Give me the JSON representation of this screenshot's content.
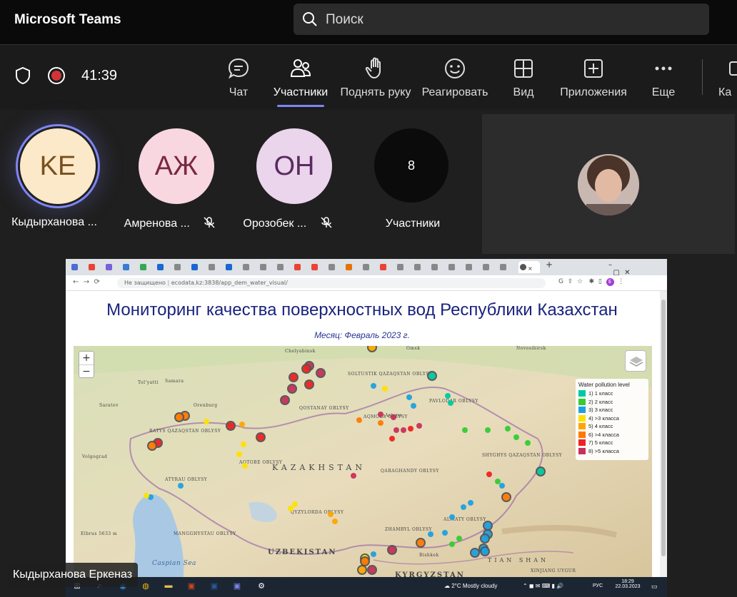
{
  "app": {
    "title": "Microsoft Teams",
    "search_placeholder": "Поиск"
  },
  "call": {
    "timer": "41:39",
    "recording": true
  },
  "toolbar": {
    "items": [
      {
        "label": "Чат",
        "icon": "chat-icon"
      },
      {
        "label": "Участники",
        "icon": "people-icon",
        "active": true
      },
      {
        "label": "Поднять руку",
        "icon": "raise-hand-icon"
      },
      {
        "label": "Реагировать",
        "icon": "smiley-icon"
      },
      {
        "label": "Вид",
        "icon": "grid-view-icon"
      },
      {
        "label": "Приложения",
        "icon": "add-app-icon"
      },
      {
        "label": "Еще",
        "icon": "more-icon"
      },
      {
        "label": "Ка",
        "icon": "camera-icon"
      }
    ]
  },
  "participants": [
    {
      "initials": "KE",
      "name": "Кыдырханова ...",
      "muted": false,
      "bg": "#fbe9c9",
      "fg": "#7a4f1c",
      "speaking": true
    },
    {
      "initials": "АЖ",
      "name": "Амренова ...",
      "muted": true,
      "bg": "#f8d7e1",
      "fg": "#7a2842"
    },
    {
      "initials": "OH",
      "name": "Орозобек ...",
      "muted": true,
      "bg": "#ead5ec",
      "fg": "#5a2a60"
    },
    {
      "initials": "8",
      "name": "Участники",
      "muted": false,
      "bg": "#0b0b0b",
      "fg": "#ffffff"
    }
  ],
  "presenter_tag": "Кыдырханова Еркеназ",
  "shared_screen": {
    "address_insecure": "Не защищено",
    "address_url": "ecodata.kz:3838/app_dem_water_visual/",
    "page_title": "Мониторинг качества поверхностных вод Республики Казахстан",
    "month": "Месяц: Февраль 2023 г.",
    "zoom_in": "+",
    "zoom_out": "−",
    "legend": {
      "title": "Water pollution level",
      "items": [
        {
          "label": "1) 1 класс",
          "color": "#00c8a0"
        },
        {
          "label": "2) 2 класс",
          "color": "#33cc33"
        },
        {
          "label": "3) 3 класс",
          "color": "#1ea0e0"
        },
        {
          "label": "4) >3 класса",
          "color": "#ffe000"
        },
        {
          "label": "5) 4 класс",
          "color": "#ffa500"
        },
        {
          "label": "6) >4 класса",
          "color": "#ff7a00"
        },
        {
          "label": "7) 5 класс",
          "color": "#ee2222"
        },
        {
          "label": "8) >5 класса",
          "color": "#c8305a"
        }
      ]
    },
    "map_labels": [
      "KAZAKHSTAN",
      "UZBEKISTAN",
      "KYRGYZSTAN",
      "TIAN SHAN",
      "Caspian Sea",
      "Chelyabinsk",
      "Omsk",
      "Novosibirsk",
      "Samara",
      "Tol'yatti",
      "Saratov",
      "Orenburg",
      "Volgograd",
      "Astana",
      "Bishkek",
      "BATYS QAZAQSTAN OBLYSY",
      "ATYRAU OBLYSY",
      "MANGGHYSTAU OBLYSY",
      "AQTOBE OBLYSY",
      "QOSTANAY OBLYSY",
      "SOLTUSTIK QAZAQSTAN OBLYSY",
      "AQMOLA OBLYSY",
      "PAVLODAR OBLYSY",
      "QARAGHANDY OBLYSY",
      "SHYGHYS QAZAQSTAN OBLYSY",
      "ZHAMBYL OBLYSY",
      "QYZYLORDA OBLYSY",
      "ALMATY OBLYSY",
      "Elbrus 5633 m",
      "XINJIANG UYGUR"
    ]
  },
  "taskbar": {
    "weather": "2°C  Mostly cloudy",
    "lang": "РУС",
    "time": "18:29",
    "date": "22.03.2023"
  }
}
